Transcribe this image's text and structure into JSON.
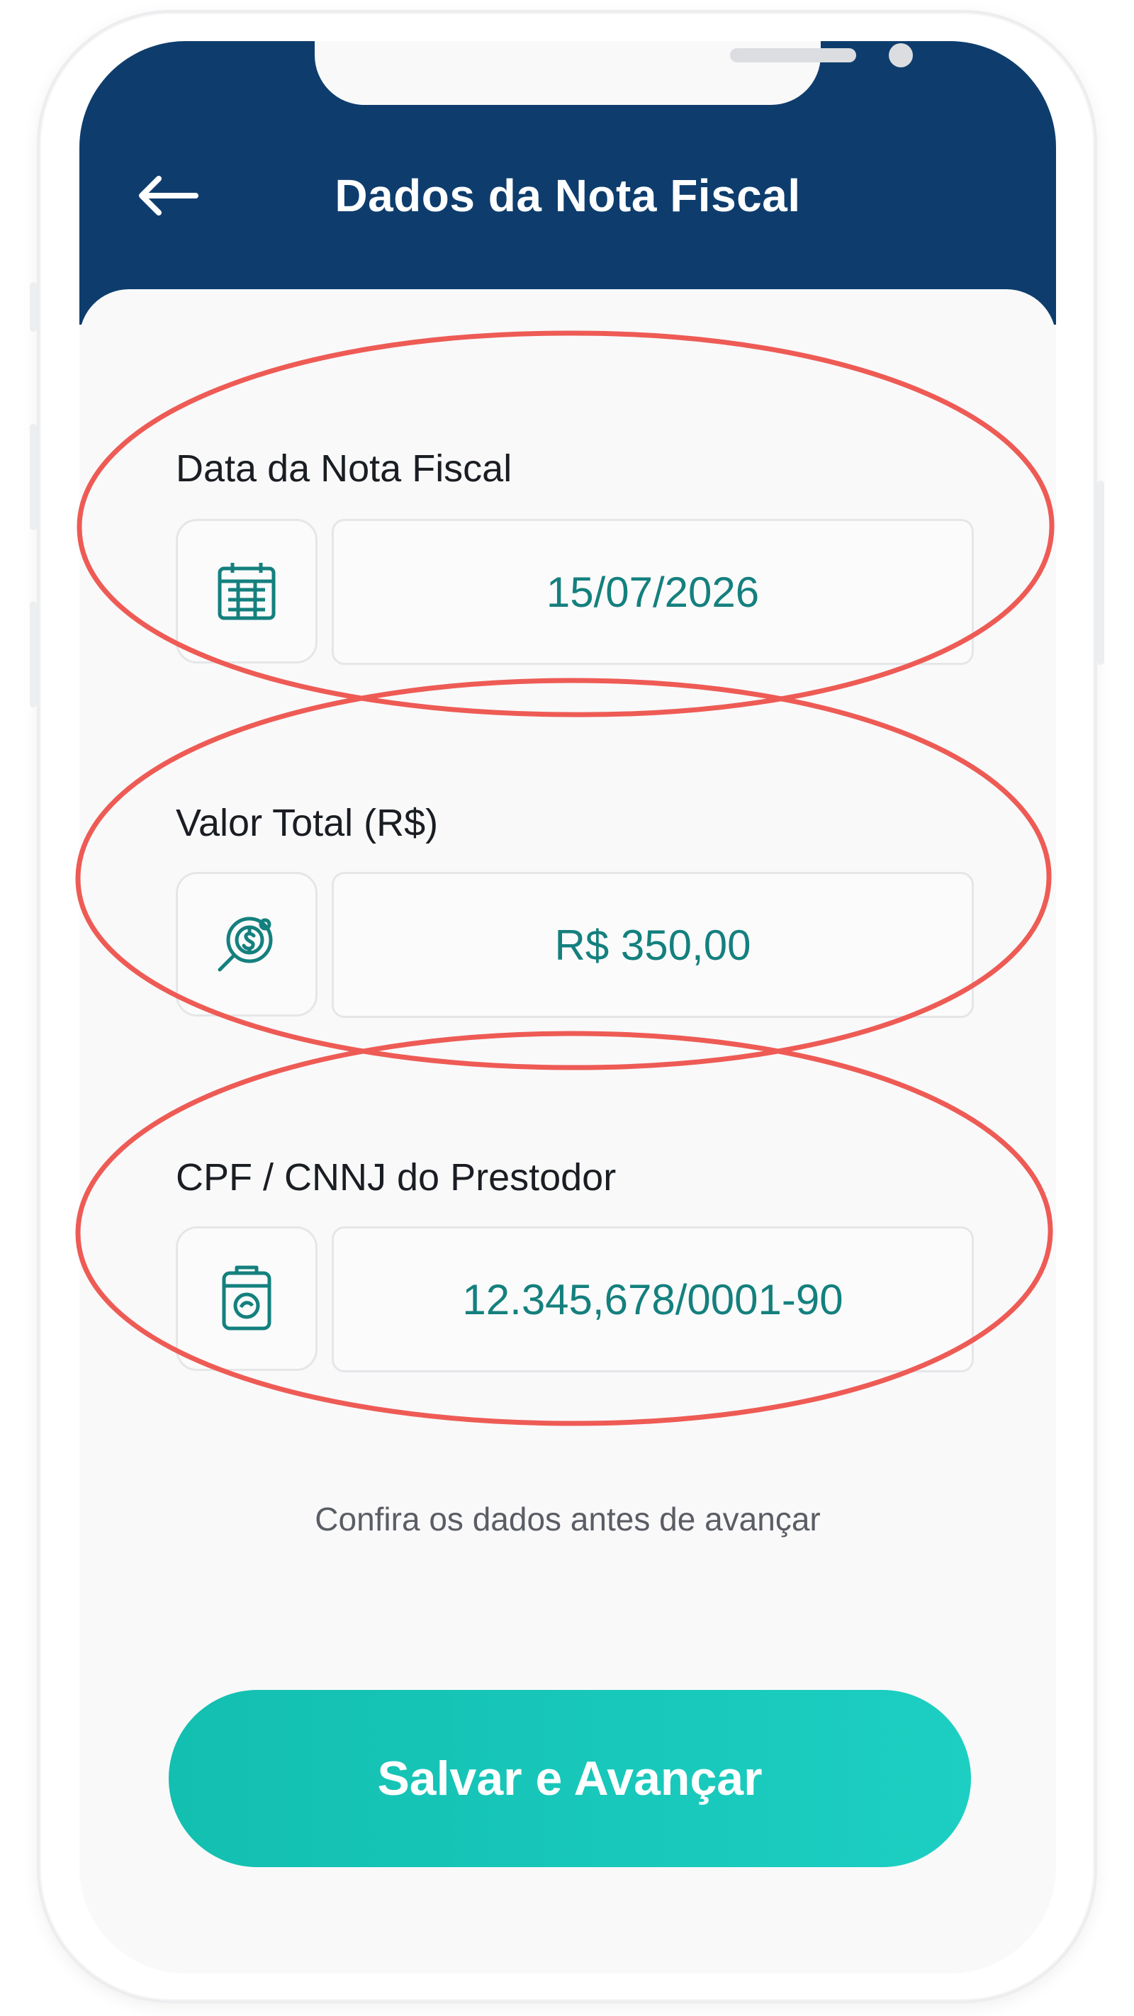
{
  "header": {
    "title": "Dados da Nota Fiscal",
    "back_icon": "arrow-left-icon",
    "background_color": "#0e3d6d"
  },
  "fields": [
    {
      "label": "Data da Nota Fiscal",
      "value": "15/07/2026",
      "icon": "calendar-icon"
    },
    {
      "label": "Valor Total (R$)",
      "value": "R$ 350,00",
      "icon": "money-search-icon"
    },
    {
      "label": "CPF / CNNJ do Prestodor",
      "value": "12.345,678/0001-90",
      "icon": "document-id-icon"
    }
  ],
  "hint": "Confira os dados antes de avançar",
  "button": {
    "label": "Salvar e Avançar",
    "color": "#17c7b8"
  },
  "colors": {
    "accent": "#14807e",
    "annotation": "#ee5b55"
  }
}
